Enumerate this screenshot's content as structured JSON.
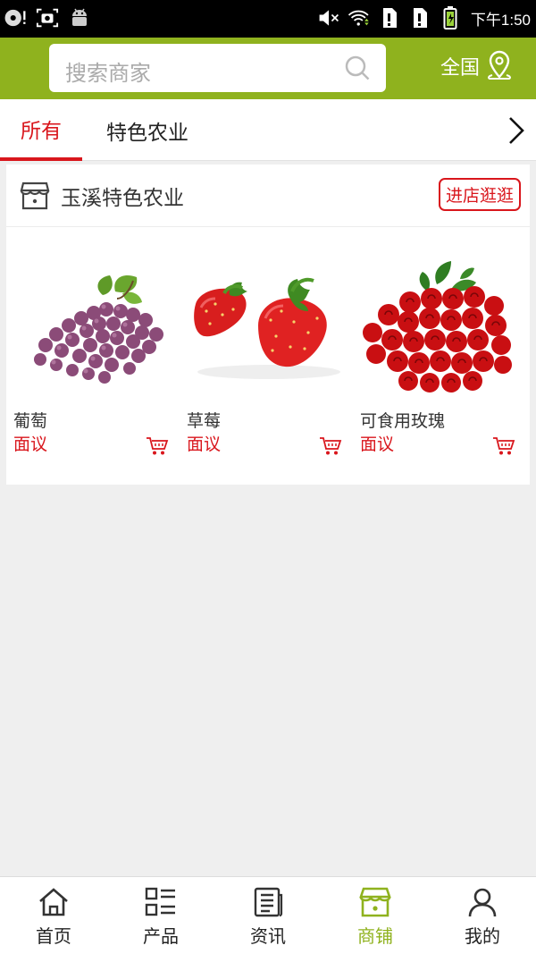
{
  "status_bar": {
    "time": "下午1:50",
    "left_icons": [
      "record-icon",
      "screenshot-icon",
      "android-icon"
    ],
    "right_icons": [
      "mute-icon",
      "wifi-icon",
      "sim1-icon",
      "sim2-icon",
      "battery-icon"
    ]
  },
  "header": {
    "search_placeholder": "搜索商家",
    "region_label": "全国",
    "bg_color": "#8fb21e"
  },
  "tabs": {
    "items": [
      {
        "label": "所有",
        "active": true
      },
      {
        "label": "特色农业",
        "active": false
      }
    ],
    "accent_color": "#d9161c"
  },
  "shop": {
    "name": "玉溪特色农业",
    "visit_button": "进店逛逛",
    "products": [
      {
        "name": "葡萄",
        "price": "面议",
        "image": "grapes"
      },
      {
        "name": "草莓",
        "price": "面议",
        "image": "strawberries"
      },
      {
        "name": "可食用玫瑰",
        "price": "面议",
        "image": "roses"
      }
    ]
  },
  "bottom_nav": {
    "items": [
      {
        "label": "首页",
        "icon": "home-icon",
        "active": false
      },
      {
        "label": "产品",
        "icon": "product-list-icon",
        "active": false
      },
      {
        "label": "资讯",
        "icon": "news-icon",
        "active": false
      },
      {
        "label": "商铺",
        "icon": "store-icon",
        "active": true
      },
      {
        "label": "我的",
        "icon": "user-icon",
        "active": false
      }
    ]
  }
}
